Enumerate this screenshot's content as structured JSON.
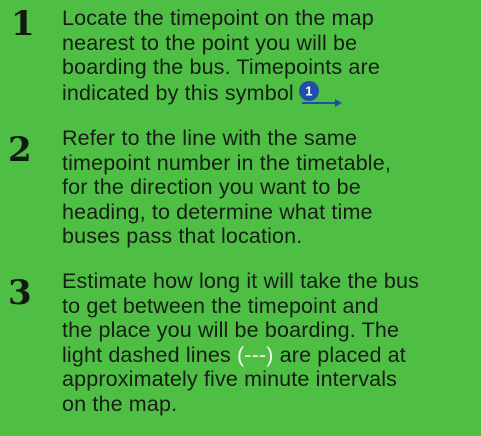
{
  "colors": {
    "background": "#4fbe45",
    "text": "#161d14",
    "icon_circle": "#1f4fa8",
    "icon_arrow": "#1f4fa8",
    "highlight": "#f4f6e8"
  },
  "steps": [
    {
      "number": "1",
      "lines": [
        "Locate the timepoint on the map",
        "nearest to the point you will be",
        "boarding the bus. Timepoints are"
      ],
      "last_line": "indicated by this symbol",
      "icon": {
        "name": "timepoint-symbol-icon",
        "digit": "1"
      }
    },
    {
      "number": "2",
      "lines": [
        "Refer to the line with the same",
        "timepoint number in the timetable,",
        "for the direction you want to be",
        "heading, to determine what time",
        "buses pass that location."
      ]
    },
    {
      "number": "3",
      "lines": [
        "Estimate how long it will take the bus",
        "to get between the timepoint and",
        "the place you will be boarding. The"
      ],
      "line4_before": "light dashed lines ",
      "line4_highlight": "(---)",
      "line4_after": " are placed at",
      "lines_end": [
        "approximately five minute intervals",
        "on the map."
      ]
    }
  ]
}
